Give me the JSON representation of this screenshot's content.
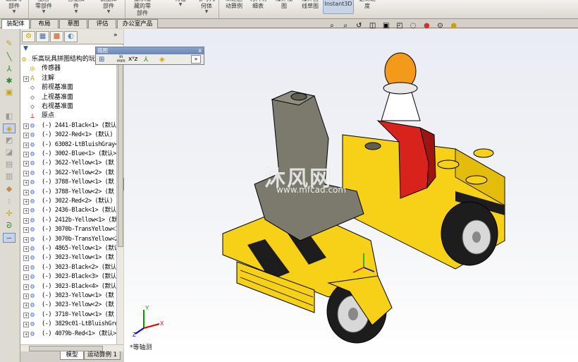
{
  "ribbon": {
    "buttons": [
      {
        "label": "编辑零\n部件"
      },
      {
        "label": "配合\n零部件"
      },
      {
        "label": "智能扣\n件"
      },
      {
        "label": "装配体\n部件"
      },
      {
        "label": "显示隐\n藏的零\n部件"
      },
      {
        "label": "特征"
      },
      {
        "label": "参考几\n何体"
      },
      {
        "label": "新建运\n动算例"
      },
      {
        "label": "材料明\n细表"
      },
      {
        "label": "爆炸视\n图"
      },
      {
        "label": "爆炸直\n线草图"
      },
      {
        "label": "Instant3D"
      },
      {
        "label": "更新速\n度"
      }
    ]
  },
  "tabs": [
    "装配体",
    "布局",
    "草图",
    "评估",
    "办公室产品"
  ],
  "floating_toolbar": {
    "title": "插图",
    "close": "x",
    "units_top": "in",
    "units_bottom": "mm"
  },
  "feature_tree": {
    "root": "乐高玩具拼图结构的玩",
    "items": [
      {
        "label": "传感器",
        "type": "sensor"
      },
      {
        "label": "注解",
        "type": "annotation"
      },
      {
        "label": "前视基准面",
        "type": "plane"
      },
      {
        "label": "上视基准面",
        "type": "plane"
      },
      {
        "label": "右视基准面",
        "type": "plane"
      },
      {
        "label": "原点",
        "type": "origin"
      },
      {
        "label": "(-) 2441-Black<1> (默认",
        "type": "part"
      },
      {
        "label": "(-) 3022-Red<1> (默认)",
        "type": "part"
      },
      {
        "label": "(-) 63082-LtBluishGray<",
        "type": "part"
      },
      {
        "label": "(-) 3002-Blue<1> (默认>",
        "type": "part"
      },
      {
        "label": "(-) 3622-Yellow<1> (默",
        "type": "part"
      },
      {
        "label": "(-) 3622-Yellow<2> (默",
        "type": "part"
      },
      {
        "label": "(-) 3788-Yellow<1> (默",
        "type": "part"
      },
      {
        "label": "(-) 3788-Yellow<2> (默",
        "type": "part"
      },
      {
        "label": "(-) 3022-Red<2> (默认)",
        "type": "part"
      },
      {
        "label": "(-) 2436-Black<1> (默认",
        "type": "part"
      },
      {
        "label": "(-) 2412b-Yellow<1> (默",
        "type": "part"
      },
      {
        "label": "(-) 3070b-TransYellow<1",
        "type": "part"
      },
      {
        "label": "(-) 3070b-TransYellow<2",
        "type": "part"
      },
      {
        "label": "(-) 4865-Yellow<1> (默认",
        "type": "part"
      },
      {
        "label": "(-) 3023-Yellow<1> (默",
        "type": "part"
      },
      {
        "label": "(-) 3023-Black<2> (默认",
        "type": "part"
      },
      {
        "label": "(-) 3023-Black<3> (默认",
        "type": "part"
      },
      {
        "label": "(-) 3023-Black<4> (默认",
        "type": "part"
      },
      {
        "label": "(-) 3023-Yellow<1> (默",
        "type": "part"
      },
      {
        "label": "(-) 3023-Yellow<2> (默",
        "type": "part"
      },
      {
        "label": "(-) 3710-Yellow<1> (默",
        "type": "part"
      },
      {
        "label": "(-) 3829c01-LtBluishGre",
        "type": "part"
      },
      {
        "label": "(-) 4079b-Red<1> (默认>",
        "type": "part"
      }
    ]
  },
  "bottom_tabs": [
    "模型",
    "运动算例 1"
  ],
  "viewport": {
    "view_label": "*等轴测",
    "watermark": "沐风网",
    "watermark_url": "www.mfcad.com",
    "axis_labels": {
      "x": "X",
      "y": "Y",
      "z": "Z"
    }
  },
  "colors": {
    "yellow": "#f7d117",
    "black": "#1d1d1d",
    "red": "#d8231c",
    "gray": "#7b7a6d",
    "orange": "#f39a1b"
  }
}
